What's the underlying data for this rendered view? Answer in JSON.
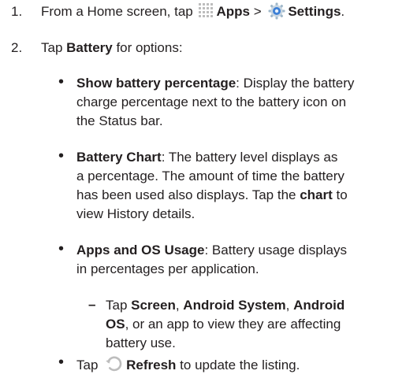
{
  "step1": {
    "number": "1.",
    "text_a": "From a Home screen, tap ",
    "apps_label": "Apps",
    "sep": " > ",
    "settings_label": "Settings",
    "end": "."
  },
  "step2": {
    "number": "2.",
    "text_a": "Tap ",
    "battery_label": "Battery",
    "text_b": " for options:"
  },
  "bullet1": {
    "term": "Show battery percentage",
    "lines": [
      ": Display the battery",
      "charge percentage next to the battery icon on",
      "the Status bar."
    ]
  },
  "bullet2": {
    "term": "Battery Chart",
    "lines": [
      ": The battery level displays as",
      "a percentage. The amount of time the battery",
      "has been used also displays. Tap the "
    ],
    "chart_word": "chart",
    "after_chart": " to",
    "last": "view History details."
  },
  "bullet3": {
    "term": "Apps and OS Usage",
    "lines": [
      ": Battery usage displays",
      "in percentages per application."
    ]
  },
  "sub": {
    "tap": "Tap ",
    "screen": "Screen",
    "comma1": ", ",
    "android_system": "Android System",
    "comma2": ", ",
    "android": "Android",
    "os": "OS",
    "rest1": ", or an app to view they are affecting",
    "rest2": "battery use."
  },
  "bullet4": {
    "tap": "Tap ",
    "refresh_label": "Refresh",
    "rest": " to update the listing."
  },
  "glyphs": {
    "bullet": "•",
    "dash": "–"
  },
  "icons": {
    "apps": "apps-grid-icon",
    "settings": "settings-gear-icon",
    "refresh": "refresh-icon"
  },
  "colors": {
    "text": "#231f20",
    "icon_grey": "#bdbdbd",
    "settings_blue": "#3b7fd6"
  }
}
